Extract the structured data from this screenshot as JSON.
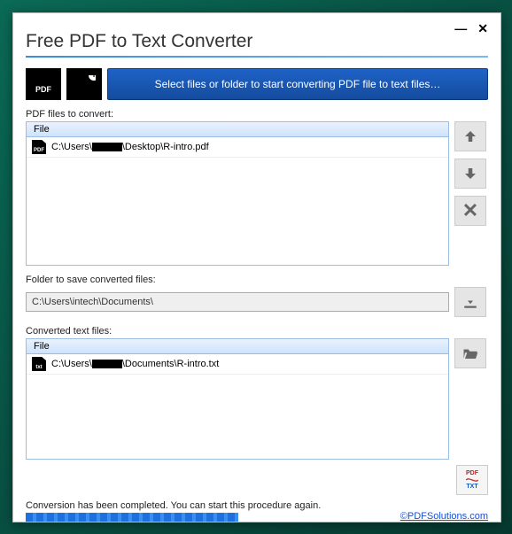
{
  "window": {
    "title": "Free PDF to Text Converter"
  },
  "toolbar": {
    "select_banner": "Select files or folder to start converting PDF file to text files…"
  },
  "pdf_section": {
    "label": "PDF files to convert:",
    "column_header": "File",
    "rows": [
      {
        "icon_label": "PDF",
        "prefix": "C:\\Users\\",
        "redacted": true,
        "suffix": "\\Desktop\\R-intro.pdf"
      }
    ]
  },
  "output_folder": {
    "label": "Folder to save converted files:",
    "value": "C:\\Users\\intech\\Documents\\"
  },
  "converted_section": {
    "label": "Converted text files:",
    "column_header": "File",
    "rows": [
      {
        "icon_label": "txt",
        "prefix": "C:\\Users\\",
        "redacted": true,
        "suffix": "\\Documents\\R-intro.txt"
      }
    ]
  },
  "status": {
    "message": "Conversion has been completed. You can start this procedure again.",
    "progress_pct": 100,
    "link_text": "©PDFSolutions.com"
  }
}
